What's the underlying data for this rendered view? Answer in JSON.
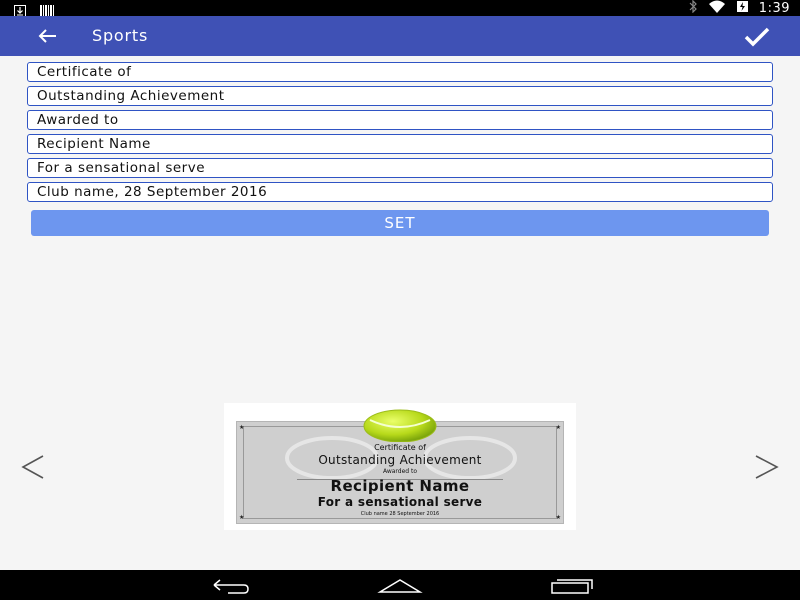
{
  "status_bar": {
    "time": "1:39",
    "icons": [
      "download-icon",
      "barcode-icon",
      "bluetooth-icon",
      "wifi-icon",
      "battery-charging-icon"
    ]
  },
  "app_bar": {
    "title": "Sports",
    "background": "#3f51b5",
    "back_icon": "arrow-left-icon",
    "confirm_icon": "check-icon"
  },
  "form": {
    "fields": [
      "Certificate of",
      "Outstanding Achievement",
      "Awarded to",
      "Recipient Name",
      "For a sensational serve",
      "Club name, 28 September 2016"
    ],
    "set_label": "SET",
    "set_color": "#6d96ef"
  },
  "preview": {
    "lines": {
      "line1": "Certificate of",
      "line2": "Outstanding Achievement",
      "line3": "Awarded to",
      "line4": "Recipient Name",
      "line5": "For a sensational serve",
      "line6": "Club name 28 September 2016"
    },
    "prev_icon": "chevron-left-icon",
    "next_icon": "chevron-right-icon"
  },
  "nav_bar": {
    "icons": [
      "back-nav-icon",
      "home-nav-icon",
      "recents-nav-icon"
    ]
  }
}
